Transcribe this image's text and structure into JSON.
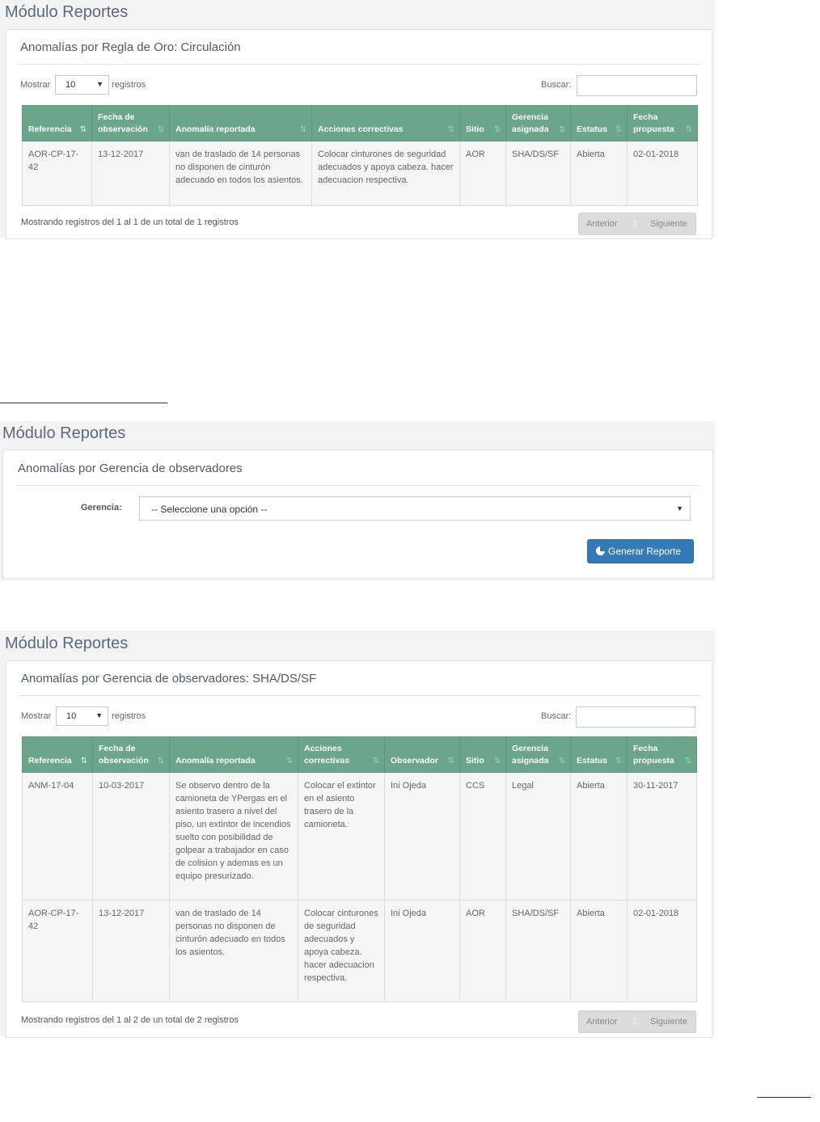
{
  "section1": {
    "module_title": "Módulo Reportes",
    "panel_title": "Anomalías por Regla de Oro: Circulación",
    "show_label": "Mostrar",
    "show_value": "10",
    "records_label": "registros",
    "search_label": "Buscar:",
    "columns": [
      "Referencia",
      "Fecha de observación",
      "Anomalía reportada",
      "Acciones correctivas",
      "Sitio",
      "Gerencia asignada",
      "Estatus",
      "Fecha propuesta"
    ],
    "rows": [
      [
        "AOR-CP-17-42",
        "13-12-2017",
        "van de traslado de 14 personas no disponen de cinturón adecuado en todos los asientos.",
        "Colocar cinturones de seguridad adecuados y apoya cabeza. hacer adecuacion respectiva.",
        "AOR",
        "SHA/DS/SF",
        "Abierta",
        "02-01-2018"
      ]
    ],
    "info": "Mostrando registros del 1 al 1 de un total de 1 registros",
    "pager": {
      "prev": "Anterior",
      "page": "1",
      "next": "Siguiente"
    }
  },
  "section2": {
    "module_title": "Módulo Reportes",
    "panel_title": "Anomalías por Gerencia de observadores",
    "field_label": "Gerencia:",
    "select_value": "-- Seleccione una opción --",
    "button_label": "Generar Reporte"
  },
  "section3": {
    "module_title": "Módulo Reportes",
    "panel_title": "Anomalías por Gerencia de observadores: SHA/DS/SF",
    "show_label": "Mostrar",
    "show_value": "10",
    "records_label": "registros",
    "search_label": "Buscar:",
    "columns": [
      "Referencia",
      "Fecha de observación",
      "Anomalía reportada",
      "Acciones correctivas",
      "Observador",
      "Sitio",
      "Gerencia asignada",
      "Estatus",
      "Fecha propuesta"
    ],
    "rows": [
      [
        "ANM-17-04",
        "10-03-2017",
        "Se observo dentro de la camioneta de YPergas en el asiento trasero a nivel del piso, un extintor de incendios suelto con posibilidad de golpear a trabajador en caso de colision y ademas es un equipo presurizado.",
        "Colocar el extintor en el asiento trasero de la camioneta.",
        "Ini Ojeda",
        "CCS",
        "Legal",
        "Abierta",
        "30-11-2017"
      ],
      [
        "AOR-CP-17-42",
        "13-12-2017",
        "van de traslado de 14 personas no disponen de cinturón adecuado en todos los asientos.",
        "Colocar cinturones de seguridad adecuados y apoya cabeza. hacer adecuacion respectiva.",
        "Ini Ojeda",
        "AOR",
        "SHA/DS/SF",
        "Abierta",
        "02-01-2018"
      ]
    ],
    "info": "Mostrando registros del 1 al 2 de un total de 2 registros",
    "pager": {
      "prev": "Anterior",
      "page": "1",
      "next": "Siguiente"
    }
  }
}
